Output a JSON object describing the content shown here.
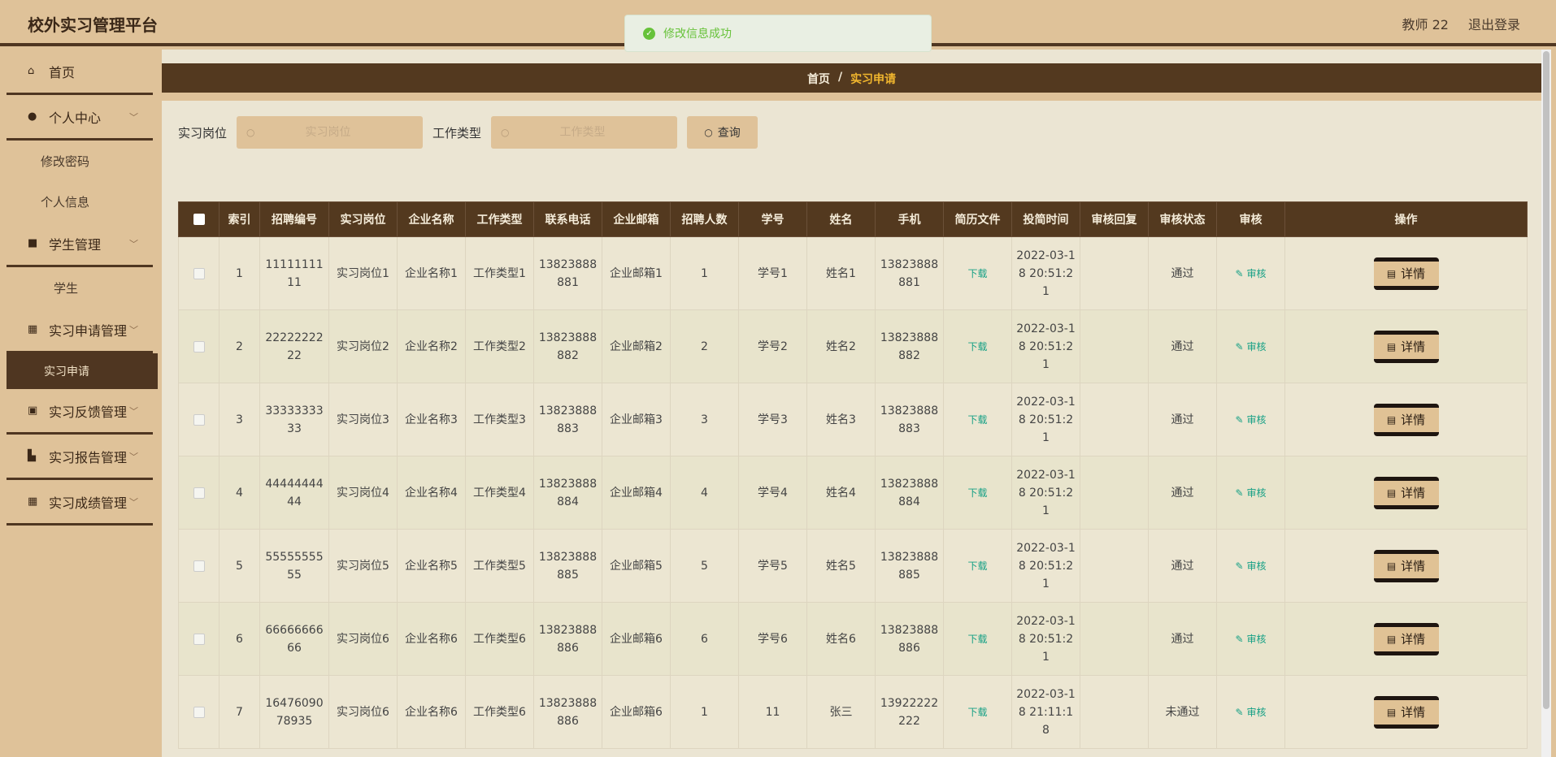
{
  "header": {
    "title": "校外实习管理平台",
    "user": "教师 22",
    "logout": "退出登录"
  },
  "toast": {
    "message": "修改信息成功",
    "icon": "success-icon",
    "color": "#67c23a"
  },
  "sidebar": {
    "home": "首页",
    "personal_center": "个人中心",
    "change_password": "修改密码",
    "personal_info": "个人信息",
    "student_mgmt": "学生管理",
    "student": "学生",
    "apply_mgmt": "实习申请管理",
    "apply": "实习申请",
    "feedback_mgmt": "实习反馈管理",
    "report_mgmt": "实习报告管理",
    "score_mgmt": "实习成绩管理"
  },
  "breadcrumb": {
    "home": "首页",
    "separator": "/",
    "current": "实习申请"
  },
  "search": {
    "position_label": "实习岗位",
    "position_placeholder": "实习岗位",
    "worktype_label": "工作类型",
    "worktype_placeholder": "工作类型",
    "query_button": "查询"
  },
  "table": {
    "headers": [
      "索引",
      "招聘编号",
      "实习岗位",
      "企业名称",
      "工作类型",
      "联系电话",
      "企业邮箱",
      "招聘人数",
      "学号",
      "姓名",
      "手机",
      "简历文件",
      "投简时间",
      "审核回复",
      "审核状态",
      "审核",
      "操作"
    ],
    "download_label": "下载",
    "audit_label": "审核",
    "detail_label": "详情",
    "rows": [
      {
        "index": "1",
        "code": "1111111111",
        "position": "实习岗位1",
        "company": "企业名称1",
        "worktype": "工作类型1",
        "phone": "13823888881",
        "email": "企业邮箱1",
        "count": "1",
        "student_no": "学号1",
        "name": "姓名1",
        "mobile": "13823888881",
        "time": "2022-03-18 20:51:21",
        "reply": "",
        "status": "通过"
      },
      {
        "index": "2",
        "code": "2222222222",
        "position": "实习岗位2",
        "company": "企业名称2",
        "worktype": "工作类型2",
        "phone": "13823888882",
        "email": "企业邮箱2",
        "count": "2",
        "student_no": "学号2",
        "name": "姓名2",
        "mobile": "13823888882",
        "time": "2022-03-18 20:51:21",
        "reply": "",
        "status": "通过"
      },
      {
        "index": "3",
        "code": "3333333333",
        "position": "实习岗位3",
        "company": "企业名称3",
        "worktype": "工作类型3",
        "phone": "13823888883",
        "email": "企业邮箱3",
        "count": "3",
        "student_no": "学号3",
        "name": "姓名3",
        "mobile": "13823888883",
        "time": "2022-03-18 20:51:21",
        "reply": "",
        "status": "通过"
      },
      {
        "index": "4",
        "code": "4444444444",
        "position": "实习岗位4",
        "company": "企业名称4",
        "worktype": "工作类型4",
        "phone": "13823888884",
        "email": "企业邮箱4",
        "count": "4",
        "student_no": "学号4",
        "name": "姓名4",
        "mobile": "13823888884",
        "time": "2022-03-18 20:51:21",
        "reply": "",
        "status": "通过"
      },
      {
        "index": "5",
        "code": "5555555555",
        "position": "实习岗位5",
        "company": "企业名称5",
        "worktype": "工作类型5",
        "phone": "13823888885",
        "email": "企业邮箱5",
        "count": "5",
        "student_no": "学号5",
        "name": "姓名5",
        "mobile": "13823888885",
        "time": "2022-03-18 20:51:21",
        "reply": "",
        "status": "通过"
      },
      {
        "index": "6",
        "code": "6666666666",
        "position": "实习岗位6",
        "company": "企业名称6",
        "worktype": "工作类型6",
        "phone": "13823888886",
        "email": "企业邮箱6",
        "count": "6",
        "student_no": "学号6",
        "name": "姓名6",
        "mobile": "13823888886",
        "time": "2022-03-18 20:51:21",
        "reply": "",
        "status": "通过"
      },
      {
        "index": "7",
        "code": "1647609078935",
        "position": "实习岗位6",
        "company": "企业名称6",
        "worktype": "工作类型6",
        "phone": "13823888886",
        "email": "企业邮箱6",
        "count": "1",
        "student_no": "11",
        "name": "张三",
        "mobile": "13922222222",
        "time": "2022-03-18 21:11:18",
        "reply": "",
        "status": "未通过"
      }
    ]
  },
  "colors": {
    "brand_dark": "#53391f",
    "brand_light": "#dfc299",
    "link": "#16a085",
    "crumb_active": "#f1b62e"
  }
}
